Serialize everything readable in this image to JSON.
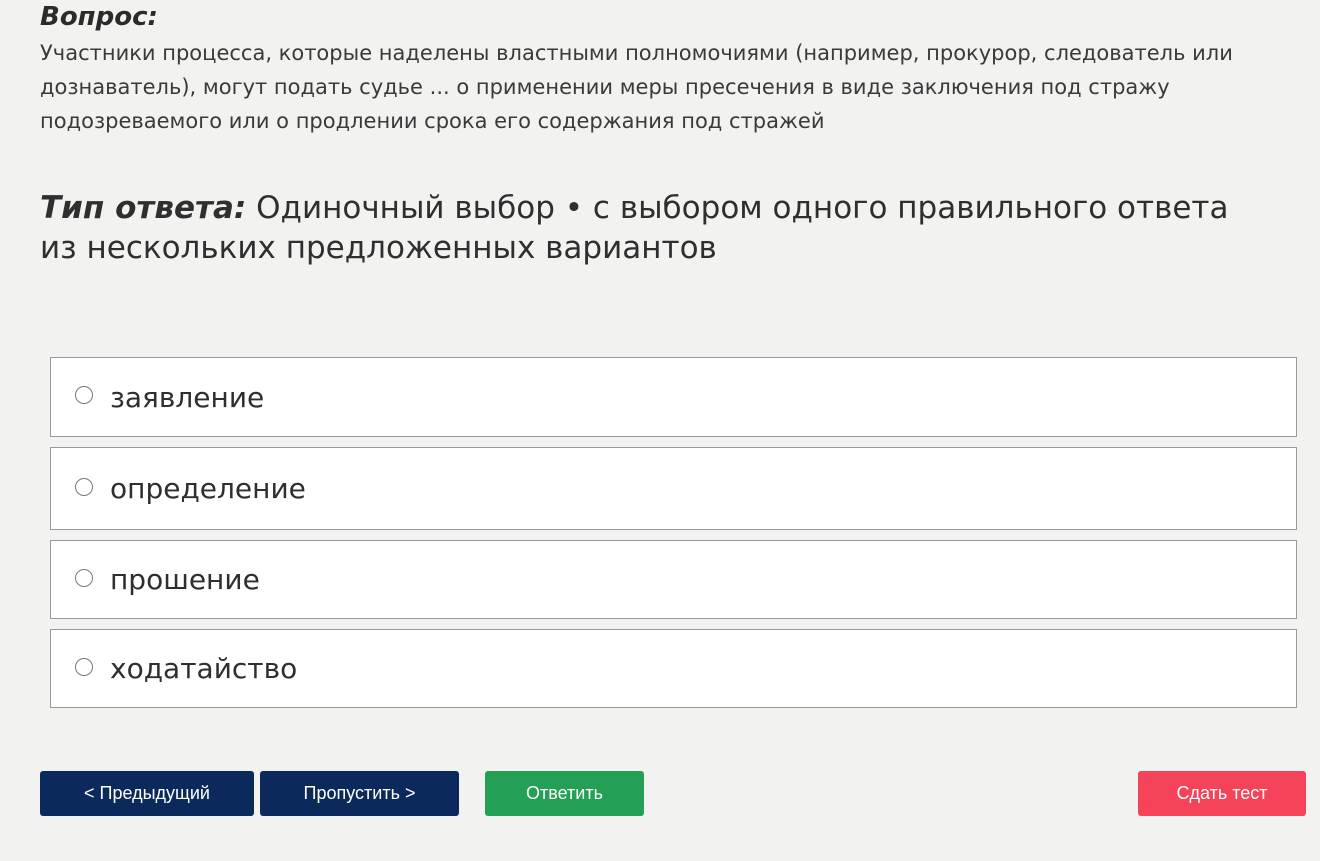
{
  "question": {
    "heading": "Вопрос:",
    "text": "Участники процесса, которые наделены властными полномочиями (например, прокурор, следователь или дознаватель), могут подать судье ... о применении меры пресечения в виде заключения под стражу подозреваемого или о продлении срока его содержания под стражей"
  },
  "answer_type": {
    "label": "Тип ответа:",
    "value": "Одиночный выбор • с выбором одного правильного ответа из нескольких предложенных вариантов"
  },
  "options": [
    {
      "label": "заявление",
      "selected": false
    },
    {
      "label": "определение",
      "selected": false
    },
    {
      "label": "прошение",
      "selected": false
    },
    {
      "label": "ходатайство",
      "selected": false
    }
  ],
  "buttons": {
    "prev": "< Предыдущий",
    "skip": "Пропустить >",
    "answer": "Ответить",
    "submit": "Сдать тест"
  },
  "colors": {
    "background": "#f2f2f0",
    "nav_button": "#0b2a5b",
    "answer_button": "#23a055",
    "submit_button": "#f5435a"
  }
}
